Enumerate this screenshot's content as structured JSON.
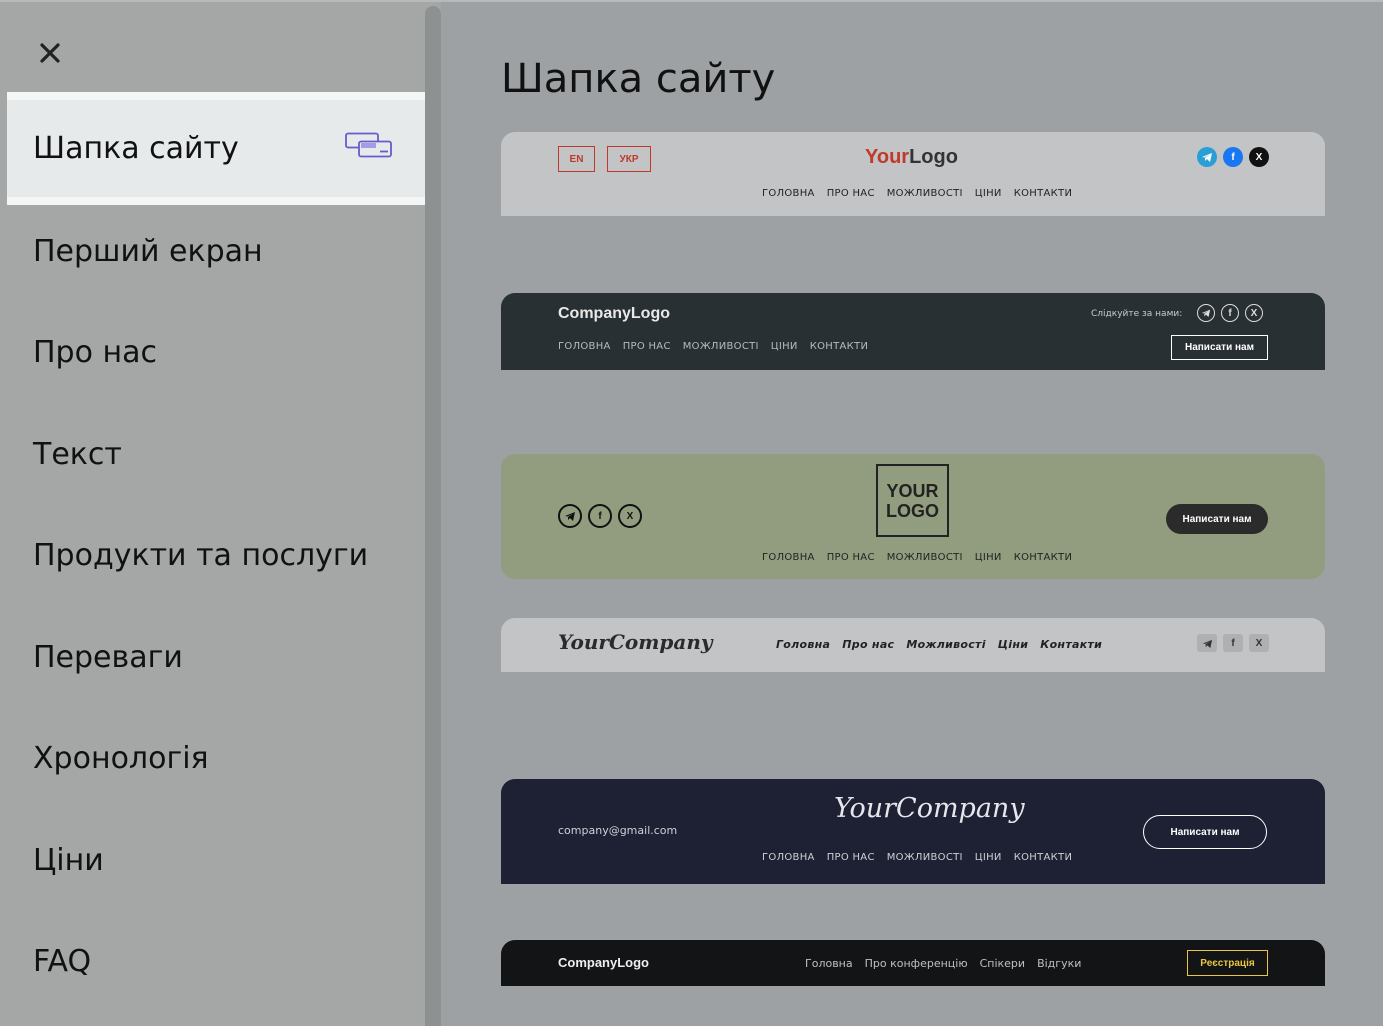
{
  "sidebar": {
    "close_icon": "close-icon",
    "items": [
      {
        "label": "Шапка сайту",
        "active": true,
        "icon": "layout-icon"
      },
      {
        "label": "Перший екран"
      },
      {
        "label": "Про нас"
      },
      {
        "label": "Текст"
      },
      {
        "label": "Продукти та послуги"
      },
      {
        "label": "Переваги"
      },
      {
        "label": "Хронологія"
      },
      {
        "label": "Ціни"
      },
      {
        "label": "FAQ"
      }
    ]
  },
  "main": {
    "title": "Шапка сайту",
    "templates": [
      {
        "lang": [
          "EN",
          "УКР"
        ],
        "logo_part1": "Your",
        "logo_part2": "Logo",
        "nav": [
          "ГОЛОВНА",
          "ПРО НАС",
          "МОЖЛИВОСТІ",
          "ЦІНИ",
          "КОНТАКТИ"
        ],
        "socials": [
          "telegram-icon",
          "facebook-icon",
          "x-icon"
        ],
        "accent": "#c0392b"
      },
      {
        "logo": "CompanyLogo",
        "follow": "Слідкуйте за нами:",
        "nav": [
          "ГОЛОВНА",
          "ПРО НАС",
          "МОЖЛИВОСТІ",
          "ЦІНИ",
          "КОНТАКТИ"
        ],
        "button": "Написати нам",
        "background": "#293033"
      },
      {
        "logo_line1": "YOUR",
        "logo_line2": "LOGO",
        "nav": [
          "ГОЛОВНА",
          "ПРО НАС",
          "МОЖЛИВОСТІ",
          "ЦІНИ",
          "КОНТАКТИ"
        ],
        "button": "Написати нам",
        "background": "#929d7f"
      },
      {
        "logo": "YourCompany",
        "nav": [
          "Головна",
          "Про нас",
          "Можливості",
          "Ціни",
          "Контакти"
        ]
      },
      {
        "email": "company@gmail.com",
        "logo": "YourCompany",
        "nav": [
          "ГОЛОВНА",
          "ПРО НАС",
          "МОЖЛИВОСТІ",
          "ЦІНИ",
          "КОНТАКТИ"
        ],
        "button": "Написати нам",
        "background": "#1e2033"
      },
      {
        "logo": "CompanyLogo",
        "nav": [
          "Головна",
          "Про конференцію",
          "Спікери",
          "Відгуки"
        ],
        "button": "Реєстрація",
        "accent": "#e8c547"
      }
    ]
  }
}
